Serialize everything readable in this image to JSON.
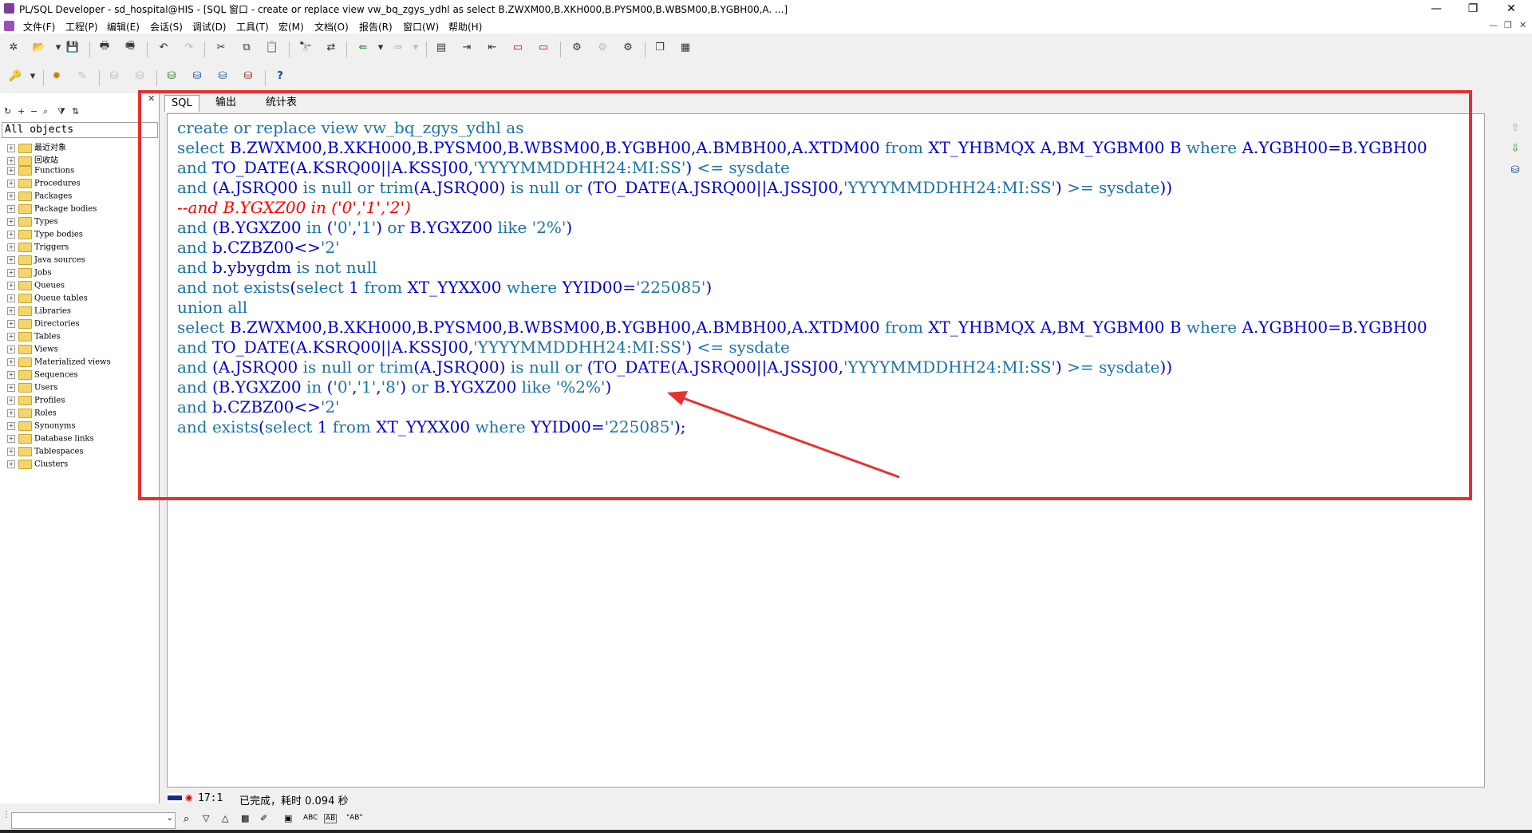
{
  "window": {
    "title": "PL/SQL Developer - sd_hospital@HIS - [SQL 窗口 - create or replace view vw_bq_zgys_ydhl as select B.ZWXM00,B.XKH000,B.PYSM00,B.WBSM00,B.YGBH00,A. ...]",
    "minimize": "—",
    "restore": "❐",
    "close": "✕"
  },
  "menu": {
    "items": [
      "文件(F)",
      "工程(P)",
      "编辑(E)",
      "会话(S)",
      "调试(D)",
      "工具(T)",
      "宏(M)",
      "文档(O)",
      "报告(R)",
      "窗口(W)",
      "帮助(H)"
    ],
    "mdi_min": "—",
    "mdi_restore": "❐",
    "mdi_close": "✕"
  },
  "toolbar1": [
    "new",
    "open",
    "save",
    "print",
    "print-preview",
    "undo",
    "redo",
    "cut",
    "copy",
    "paste",
    "find",
    "replace",
    "load",
    "export",
    "indent",
    "outdent",
    "comment",
    "uncomment",
    "execute",
    "break",
    "commit",
    "rollback",
    "window-list",
    "cascade"
  ],
  "toolbar2": [
    "key",
    "settings",
    "edit",
    "db1",
    "db2",
    "connect",
    "disconnect",
    "logon",
    "session",
    "help"
  ],
  "left_panel": {
    "selector": "All objects",
    "tree": [
      "最近对象",
      "回收站",
      "Functions",
      "Procedures",
      "Packages",
      "Package bodies",
      "Types",
      "Type bodies",
      "Triggers",
      "Java sources",
      "Jobs",
      "Queues",
      "Queue tables",
      "Libraries",
      "Directories",
      "Tables",
      "Views",
      "Materialized views",
      "Sequences",
      "Users",
      "Profiles",
      "Roles",
      "Synonyms",
      "Database links",
      "Tablespaces",
      "Clusters"
    ]
  },
  "tabs": [
    "SQL",
    "输出",
    "统计表"
  ],
  "code": [
    [
      [
        "kw",
        "create or replace view "
      ],
      [
        "kw",
        "vw_bq_zgys_ydhl"
      ],
      [
        "kw",
        " as"
      ]
    ],
    [
      [
        "kw",
        "select "
      ],
      [
        "id",
        "B.ZWXM00,B.XKH000,B.PYSM00,B.WBSM00,B.YGBH00,A.BMBH00,A.XTDM00 "
      ],
      [
        "kw",
        "from "
      ],
      [
        "id",
        "XT_YHBMQX A,BM_YGBM00 B "
      ],
      [
        "kw",
        "where "
      ],
      [
        "id",
        "A.YGBH00=B.YGBH00"
      ]
    ],
    [
      [
        "kw",
        "and "
      ],
      [
        "id",
        "TO_DATE(A.KSRQ00||A.KSSJ00,"
      ],
      [
        "str",
        "'YYYYMMDDHH24:MI:SS'"
      ],
      [
        "id",
        ") "
      ],
      [
        "kw",
        "<= sysdate"
      ]
    ],
    [
      [
        "kw",
        "and "
      ],
      [
        "id",
        "(A.JSRQ00 "
      ],
      [
        "kw",
        "is null or trim"
      ],
      [
        "id",
        "(A.JSRQ00) "
      ],
      [
        "kw",
        "is null or "
      ],
      [
        "id",
        "(TO_DATE(A.JSRQ00||A.JSSJ00,"
      ],
      [
        "str",
        "'YYYYMMDDHH24:MI:SS'"
      ],
      [
        "id",
        ") "
      ],
      [
        "kw",
        ">= sysdate"
      ],
      [
        "id",
        "))"
      ]
    ],
    [
      [
        "cm",
        "--and B.YGXZ00 in ('0','1','2')"
      ]
    ],
    [
      [
        "kw",
        "and "
      ],
      [
        "id",
        "(B.YGXZ00 "
      ],
      [
        "kw",
        "in "
      ],
      [
        "id",
        "("
      ],
      [
        "str",
        "'0'"
      ],
      [
        "id",
        ","
      ],
      [
        "str",
        "'1'"
      ],
      [
        "id",
        ") "
      ],
      [
        "kw",
        "or "
      ],
      [
        "id",
        "B.YGXZ00 "
      ],
      [
        "kw",
        "like "
      ],
      [
        "str",
        "'2%'"
      ],
      [
        "id",
        ")"
      ]
    ],
    [
      [
        "kw",
        "and "
      ],
      [
        "id",
        "b.CZBZ00<>"
      ],
      [
        "str",
        "'2'"
      ]
    ],
    [
      [
        "kw",
        "and "
      ],
      [
        "id",
        "b.ybygdm "
      ],
      [
        "kw",
        "is not null"
      ]
    ],
    [
      [
        "kw",
        "and not exists"
      ],
      [
        "id",
        "("
      ],
      [
        "kw",
        "select "
      ],
      [
        "id",
        "1 "
      ],
      [
        "kw",
        "from "
      ],
      [
        "id",
        "XT_YYXX00 "
      ],
      [
        "kw",
        "where "
      ],
      [
        "id",
        "YYID00="
      ],
      [
        "str",
        "'225085'"
      ],
      [
        "id",
        ")"
      ]
    ],
    [
      [
        "kw",
        "union all"
      ]
    ],
    [
      [
        "kw",
        "select "
      ],
      [
        "id",
        "B.ZWXM00,B.XKH000,B.PYSM00,B.WBSM00,B.YGBH00,A.BMBH00,A.XTDM00 "
      ],
      [
        "kw",
        "from "
      ],
      [
        "id",
        "XT_YHBMQX A,BM_YGBM00 B "
      ],
      [
        "kw",
        "where "
      ],
      [
        "id",
        "A.YGBH00=B.YGBH00"
      ]
    ],
    [
      [
        "kw",
        "and "
      ],
      [
        "id",
        "TO_DATE(A.KSRQ00||A.KSSJ00,"
      ],
      [
        "str",
        "'YYYYMMDDHH24:MI:SS'"
      ],
      [
        "id",
        ") "
      ],
      [
        "kw",
        "<= sysdate"
      ]
    ],
    [
      [
        "kw",
        "and "
      ],
      [
        "id",
        "(A.JSRQ00 "
      ],
      [
        "kw",
        "is null or trim"
      ],
      [
        "id",
        "(A.JSRQ00) "
      ],
      [
        "kw",
        "is null or "
      ],
      [
        "id",
        "(TO_DATE(A.JSRQ00||A.JSSJ00,"
      ],
      [
        "str",
        "'YYYYMMDDHH24:MI:SS'"
      ],
      [
        "id",
        ") "
      ],
      [
        "kw",
        ">= sysdate"
      ],
      [
        "id",
        "))"
      ]
    ],
    [
      [
        "kw",
        "and "
      ],
      [
        "id",
        "(B.YGXZ00 "
      ],
      [
        "kw",
        "in "
      ],
      [
        "id",
        "("
      ],
      [
        "str",
        "'0'"
      ],
      [
        "id",
        ","
      ],
      [
        "str",
        "'1'"
      ],
      [
        "id",
        ","
      ],
      [
        "str",
        "'8'"
      ],
      [
        "id",
        ") "
      ],
      [
        "kw",
        "or "
      ],
      [
        "id",
        "B.YGXZ00 "
      ],
      [
        "kw",
        "like "
      ],
      [
        "str",
        "'%2%'"
      ],
      [
        "id",
        ")"
      ]
    ],
    [
      [
        "kw",
        "and "
      ],
      [
        "id",
        "b.CZBZ00<>"
      ],
      [
        "str",
        "'2'"
      ]
    ],
    [
      [
        "kw",
        "and exists"
      ],
      [
        "id",
        "("
      ],
      [
        "kw",
        "select "
      ],
      [
        "id",
        "1 "
      ],
      [
        "kw",
        "from "
      ],
      [
        "id",
        "XT_YYXX00 "
      ],
      [
        "kw",
        "where "
      ],
      [
        "id",
        "YYID00="
      ],
      [
        "str",
        "'225085'"
      ],
      [
        "id",
        ");"
      ]
    ]
  ],
  "status": {
    "position": "17:1",
    "message": "已完成，耗时 0.094 秒"
  },
  "find_toolbar": {
    "input_value": "",
    "labels": [
      "ABC",
      "AB",
      "\"AB\""
    ]
  },
  "colors": {
    "annotation_red": "#e63030",
    "keyword": "#1a73a8",
    "identifier": "#0000cc",
    "comment": "#ff0000"
  }
}
